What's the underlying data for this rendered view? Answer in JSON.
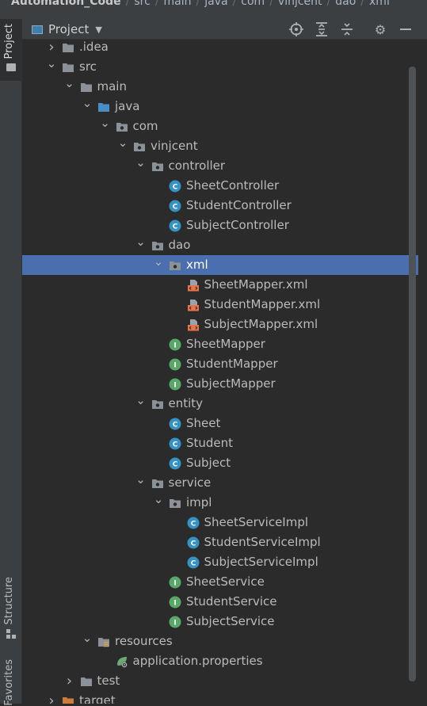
{
  "breadcrumb": [
    "Automation_Code",
    "src",
    "main",
    "java",
    "com",
    "vinjcent",
    "dao",
    "xml"
  ],
  "stripe": {
    "project": "Project",
    "structure": "Structure",
    "favorites": "Favorites"
  },
  "header": {
    "view": "Project",
    "buttons": [
      "locate-icon",
      "expand-all-icon",
      "collapse-all-icon",
      "gear-icon",
      "minimize-icon"
    ]
  },
  "colors": {
    "selection": "#4b6eaf",
    "class_icon": "#3592c4",
    "interface_icon": "#59a869",
    "xml_icon": "#e8754a",
    "source_folder": "#4a8cc6",
    "excluded_folder": "#d07a3b"
  },
  "tree": [
    {
      "label": ".idea",
      "depth": 1,
      "type": "folder",
      "arrow": "right"
    },
    {
      "label": "src",
      "depth": 1,
      "type": "folder",
      "arrow": "down"
    },
    {
      "label": "main",
      "depth": 2,
      "type": "folder",
      "arrow": "down"
    },
    {
      "label": "java",
      "depth": 3,
      "type": "source-folder",
      "arrow": "down"
    },
    {
      "label": "com",
      "depth": 4,
      "type": "package",
      "arrow": "down"
    },
    {
      "label": "vinjcent",
      "depth": 5,
      "type": "package",
      "arrow": "down"
    },
    {
      "label": "controller",
      "depth": 6,
      "type": "package",
      "arrow": "down"
    },
    {
      "label": "SheetController",
      "depth": 7,
      "type": "class"
    },
    {
      "label": "StudentController",
      "depth": 7,
      "type": "class"
    },
    {
      "label": "SubjectController",
      "depth": 7,
      "type": "class"
    },
    {
      "label": "dao",
      "depth": 6,
      "type": "package",
      "arrow": "down"
    },
    {
      "label": "xml",
      "depth": 7,
      "type": "package",
      "arrow": "down",
      "selected": true
    },
    {
      "label": "SheetMapper.xml",
      "depth": 8,
      "type": "xml"
    },
    {
      "label": "StudentMapper.xml",
      "depth": 8,
      "type": "xml"
    },
    {
      "label": "SubjectMapper.xml",
      "depth": 8,
      "type": "xml"
    },
    {
      "label": "SheetMapper",
      "depth": 7,
      "type": "interface"
    },
    {
      "label": "StudentMapper",
      "depth": 7,
      "type": "interface"
    },
    {
      "label": "SubjectMapper",
      "depth": 7,
      "type": "interface"
    },
    {
      "label": "entity",
      "depth": 6,
      "type": "package",
      "arrow": "down"
    },
    {
      "label": "Sheet",
      "depth": 7,
      "type": "class"
    },
    {
      "label": "Student",
      "depth": 7,
      "type": "class"
    },
    {
      "label": "Subject",
      "depth": 7,
      "type": "class"
    },
    {
      "label": "service",
      "depth": 6,
      "type": "package",
      "arrow": "down"
    },
    {
      "label": "impl",
      "depth": 7,
      "type": "package",
      "arrow": "down"
    },
    {
      "label": "SheetServiceImpl",
      "depth": 8,
      "type": "class"
    },
    {
      "label": "StudentServiceImpl",
      "depth": 8,
      "type": "class"
    },
    {
      "label": "SubjectServiceImpl",
      "depth": 8,
      "type": "class"
    },
    {
      "label": "SheetService",
      "depth": 7,
      "type": "interface"
    },
    {
      "label": "StudentService",
      "depth": 7,
      "type": "interface"
    },
    {
      "label": "SubjectService",
      "depth": 7,
      "type": "interface"
    },
    {
      "label": "resources",
      "depth": 3,
      "type": "resources-folder",
      "arrow": "down"
    },
    {
      "label": "application.properties",
      "depth": 4,
      "type": "properties"
    },
    {
      "label": "test",
      "depth": 2,
      "type": "folder",
      "arrow": "right"
    },
    {
      "label": "target",
      "depth": 1,
      "type": "excluded-folder",
      "arrow": "right"
    }
  ]
}
